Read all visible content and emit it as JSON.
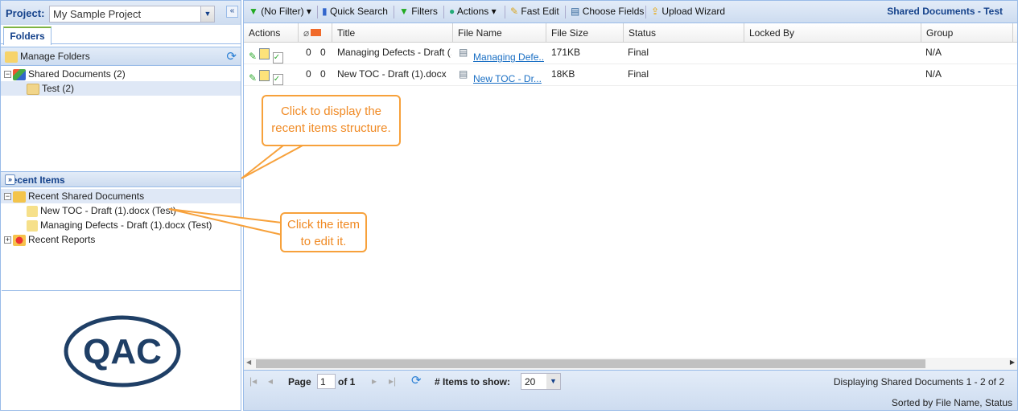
{
  "left": {
    "project_label": "Project:",
    "project_value": "My Sample Project",
    "tab": "Folders",
    "manage_folders": "Manage Folders",
    "tree": [
      {
        "label": "Shared Documents (2)"
      },
      {
        "label": "Test (2)"
      }
    ],
    "recent_title": "Recent Items",
    "recent": [
      {
        "label": "Recent Shared Documents"
      },
      {
        "label": "New TOC - Draft (1).docx (Test)"
      },
      {
        "label": "Managing Defects - Draft (1).docx (Test)"
      },
      {
        "label": "Recent Reports"
      }
    ],
    "logo_text": "QAC"
  },
  "toolbar": {
    "filter": "(No Filter)",
    "quick_search": "Quick Search",
    "filters": "Filters",
    "actions": "Actions",
    "fast_edit": "Fast Edit",
    "choose_fields": "Choose Fields",
    "upload_wizard": "Upload Wizard",
    "title": "Shared Documents - Test"
  },
  "grid": {
    "columns": [
      "Actions",
      "Title",
      "File Name",
      "File Size",
      "Status",
      "Locked By",
      "Group"
    ],
    "rows": [
      {
        "attach": "0",
        "comments": "0",
        "title": "Managing Defects - Draft (...",
        "file": "Managing Defe...",
        "size": "171KB",
        "status": "Final",
        "locked": "",
        "group": "N/A"
      },
      {
        "attach": "0",
        "comments": "0",
        "title": "New TOC - Draft (1).docx",
        "file": "New TOC - Dr...",
        "size": "18KB",
        "status": "Final",
        "locked": "",
        "group": "N/A"
      }
    ]
  },
  "pager": {
    "page_label": "Page",
    "page": "1",
    "of": "of 1",
    "items_label": "# Items to show:",
    "items": "20",
    "displaying": "Displaying Shared Documents 1 - 2 of 2",
    "sorted": "Sorted by File Name, Status"
  },
  "callouts": {
    "c1": "Click to display the recent items structure.",
    "c2": "Click the item to edit it."
  }
}
